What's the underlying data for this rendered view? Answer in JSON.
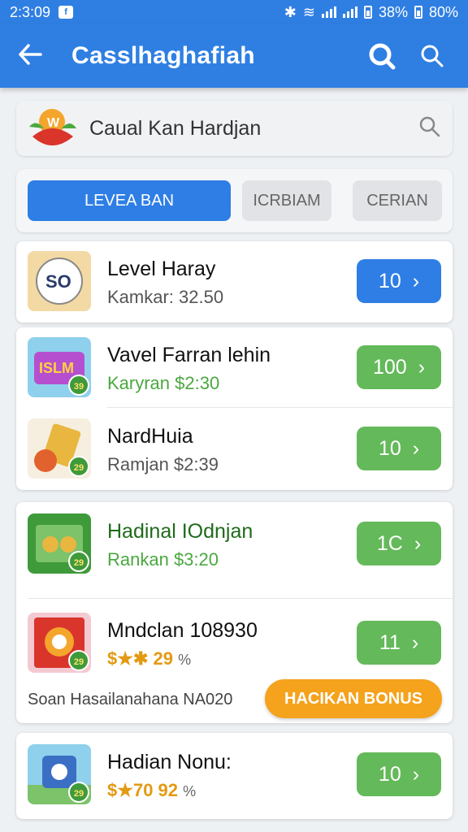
{
  "status_bar": {
    "time": "2:3:09",
    "signal_text": "38%",
    "battery_text": "80%"
  },
  "app_bar": {
    "title": "Casslhaghafiah",
    "back_icon": "arrow-left-icon",
    "search_icon": "search-icon"
  },
  "search": {
    "query": "Caual Kan Hardjan"
  },
  "tabs": [
    {
      "label": "LEVEA BAN",
      "active": true
    },
    {
      "label": "ICRBIAM",
      "active": false
    },
    {
      "label": "CERIAN",
      "active": false
    }
  ],
  "items": [
    {
      "name": "Level Haray",
      "sub": "Kamkar: 32.50",
      "button": "10",
      "badge": ""
    },
    {
      "name": "Vavel Farran lehin",
      "sub": "Karyran $2:30",
      "button": "100",
      "badge": "39"
    },
    {
      "name": "NardHuia",
      "sub": "Ramjan $2:39",
      "button": "10",
      "badge": "29"
    },
    {
      "name": "Hadinal IOdnjan",
      "sub": "Rankan $3:20",
      "button": "1C",
      "badge": "29"
    },
    {
      "name": "Mndclan 108930",
      "sub": "$★✱ 29",
      "sub_pct": "%",
      "button": "11",
      "badge": "29"
    },
    {
      "name": "Hadian Nonu:",
      "sub": "$★70 92",
      "sub_pct": "%",
      "button": "10",
      "badge": "29"
    }
  ],
  "bonus": {
    "text": "Soan Hasailanahana NA020",
    "button": "HACIKAN BONUS"
  },
  "colors": {
    "primary": "#2f7fe3",
    "green_button": "#64b95a",
    "orange_button": "#f5a21c"
  }
}
